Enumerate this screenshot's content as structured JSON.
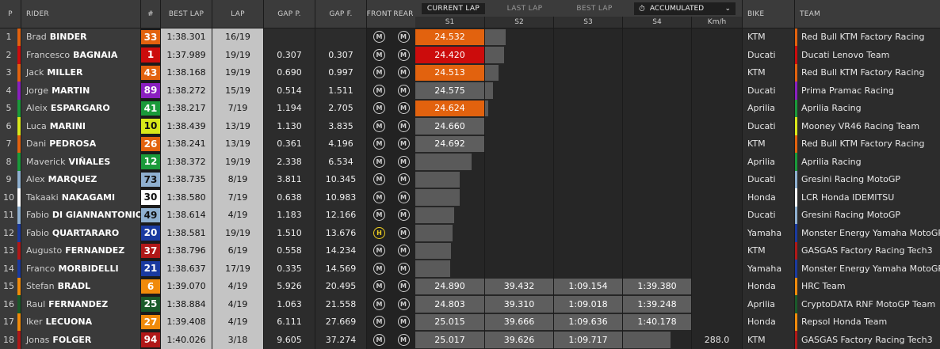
{
  "header": {
    "p": "P",
    "rider": "RIDER",
    "num": "#",
    "best_lap": "BEST LAP",
    "lap": "LAP",
    "gap_p": "GAP P.",
    "gap_f": "GAP F.",
    "front": "FRONT",
    "rear": "REAR",
    "bike": "BIKE",
    "team": "TEAM",
    "tabs": {
      "current": "CURRENT LAP",
      "last": "LAST LAP",
      "best": "BEST LAP"
    },
    "mode": "ACCUMULATED",
    "sectors": [
      "S1",
      "S2",
      "S3",
      "S4",
      "Km/h"
    ]
  },
  "colors": {
    "s1_orange": "#e2620e",
    "s1_red": "#cc0c0c",
    "s1_grey": "#5e5e5e"
  },
  "riders": [
    {
      "pos": "1",
      "first": "Brad",
      "last": "BINDER",
      "num": "33",
      "numBg": "#e2620e",
      "numFg": "#fff",
      "strip": "#e2620e",
      "best": "1:38.301",
      "lap": "16/19",
      "gp": "",
      "gf": "",
      "front": "M",
      "rear": "M",
      "s1": "24.532",
      "s1c": "orange",
      "s2": "",
      "s3": "",
      "s4": "",
      "kmh": "",
      "bar": 0.3,
      "bike": "KTM",
      "team": "Red Bull KTM Factory Racing",
      "teamColor": "#e2620e"
    },
    {
      "pos": "2",
      "first": "Francesco",
      "last": "BAGNAIA",
      "num": "1",
      "numBg": "#cc0c0c",
      "numFg": "#fff",
      "strip": "#cc0c0c",
      "best": "1:37.989",
      "lap": "19/19",
      "gp": "0.307",
      "gf": "0.307",
      "front": "M",
      "rear": "M",
      "s1": "24.420",
      "s1c": "red",
      "s2": "",
      "s3": "",
      "s4": "",
      "kmh": "",
      "bar": 0.28,
      "bike": "Ducati",
      "team": "Ducati Lenovo Team",
      "teamColor": "#cc0c0c"
    },
    {
      "pos": "3",
      "first": "Jack",
      "last": "MILLER",
      "num": "43",
      "numBg": "#e2620e",
      "numFg": "#fff",
      "strip": "#e2620e",
      "best": "1:38.168",
      "lap": "19/19",
      "gp": "0.690",
      "gf": "0.997",
      "front": "M",
      "rear": "M",
      "s1": "24.513",
      "s1c": "orange",
      "s2": "",
      "s3": "",
      "s4": "",
      "kmh": "",
      "bar": 0.2,
      "bike": "KTM",
      "team": "Red Bull KTM Factory Racing",
      "teamColor": "#e2620e"
    },
    {
      "pos": "4",
      "first": "Jorge",
      "last": "MARTIN",
      "num": "89",
      "numBg": "#8a1fc0",
      "numFg": "#fff",
      "strip": "#8a1fc0",
      "best": "1:38.272",
      "lap": "15/19",
      "gp": "0.514",
      "gf": "1.511",
      "front": "M",
      "rear": "M",
      "s1": "24.575",
      "s1c": "grey",
      "s2": "",
      "s3": "",
      "s4": "",
      "kmh": "",
      "bar": 0.12,
      "bike": "Ducati",
      "team": "Prima Pramac Racing",
      "teamColor": "#8a1fc0"
    },
    {
      "pos": "5",
      "first": "Aleix",
      "last": "ESPARGARO",
      "num": "41",
      "numBg": "#1a9a3a",
      "numFg": "#fff",
      "strip": "#1a9a3a",
      "best": "1:38.217",
      "lap": "7/19",
      "gp": "1.194",
      "gf": "2.705",
      "front": "M",
      "rear": "M",
      "s1": "24.624",
      "s1c": "orange",
      "s2": "",
      "s3": "",
      "s4": "",
      "kmh": "",
      "bar": 0.05,
      "bike": "Aprilia",
      "team": "Aprilia Racing",
      "teamColor": "#1a9a3a"
    },
    {
      "pos": "6",
      "first": "Luca",
      "last": "MARINI",
      "num": "10",
      "numBg": "#d8e81a",
      "numFg": "#111",
      "strip": "#d8e81a",
      "best": "1:38.439",
      "lap": "13/19",
      "gp": "1.130",
      "gf": "3.835",
      "front": "M",
      "rear": "M",
      "s1": "24.660",
      "s1c": "grey",
      "s2": "",
      "s3": "",
      "s4": "",
      "kmh": "",
      "bar": 0,
      "bike": "Ducati",
      "team": "Mooney VR46 Racing Team",
      "teamColor": "#d8e81a"
    },
    {
      "pos": "7",
      "first": "Dani",
      "last": "PEDROSA",
      "num": "26",
      "numBg": "#e2620e",
      "numFg": "#fff",
      "strip": "#e2620e",
      "best": "1:38.241",
      "lap": "13/19",
      "gp": "0.361",
      "gf": "4.196",
      "front": "M",
      "rear": "M",
      "s1": "24.692",
      "s1c": "grey",
      "s2": "",
      "s3": "",
      "s4": "",
      "kmh": "",
      "bar": 0,
      "bike": "KTM",
      "team": "Red Bull KTM Factory Racing",
      "teamColor": "#e2620e"
    },
    {
      "pos": "8",
      "first": "Maverick",
      "last": "VIÑALES",
      "num": "12",
      "numBg": "#1a9a3a",
      "numFg": "#fff",
      "strip": "#1a9a3a",
      "best": "1:38.372",
      "lap": "19/19",
      "gp": "2.338",
      "gf": "6.534",
      "front": "M",
      "rear": "M",
      "s1": "",
      "s1c": "bar",
      "s2": "",
      "s3": "",
      "s4": "",
      "kmh": "",
      "bar": 0.82,
      "bike": "Aprilia",
      "team": "Aprilia Racing",
      "teamColor": "#1a9a3a"
    },
    {
      "pos": "9",
      "first": "Alex",
      "last": "MARQUEZ",
      "num": "73",
      "numBg": "#8fb0d0",
      "numFg": "#111",
      "strip": "#8fb0d0",
      "best": "1:38.735",
      "lap": "8/19",
      "gp": "3.811",
      "gf": "10.345",
      "front": "M",
      "rear": "M",
      "s1": "",
      "s1c": "bar",
      "s2": "",
      "s3": "",
      "s4": "",
      "kmh": "",
      "bar": 0.64,
      "bike": "Ducati",
      "team": "Gresini Racing MotoGP",
      "teamColor": "#8fb0d0"
    },
    {
      "pos": "10",
      "first": "Takaaki",
      "last": "NAKAGAMI",
      "num": "30",
      "numBg": "#ffffff",
      "numFg": "#111",
      "strip": "#ffffff",
      "best": "1:38.580",
      "lap": "7/19",
      "gp": "0.638",
      "gf": "10.983",
      "front": "M",
      "rear": "M",
      "s1": "",
      "s1c": "bar",
      "s2": "",
      "s3": "",
      "s4": "",
      "kmh": "",
      "bar": 0.64,
      "bike": "Honda",
      "team": "LCR Honda IDEMITSU",
      "teamColor": "#ffffff"
    },
    {
      "pos": "11",
      "first": "Fabio",
      "last": "DI GIANNANTONIO",
      "num": "49",
      "numBg": "#8fb0d0",
      "numFg": "#111",
      "strip": "#8fb0d0",
      "best": "1:38.614",
      "lap": "4/19",
      "gp": "1.183",
      "gf": "12.166",
      "front": "M",
      "rear": "M",
      "s1": "",
      "s1c": "bar",
      "s2": "",
      "s3": "",
      "s4": "",
      "kmh": "",
      "bar": 0.56,
      "bike": "Ducati",
      "team": "Gresini Racing MotoGP",
      "teamColor": "#8fb0d0"
    },
    {
      "pos": "12",
      "first": "Fabio",
      "last": "QUARTARARO",
      "num": "20",
      "numBg": "#1a3aa0",
      "numFg": "#fff",
      "strip": "#1a3aa0",
      "best": "1:38.581",
      "lap": "19/19",
      "gp": "1.510",
      "gf": "13.676",
      "front": "H",
      "rear": "M",
      "s1": "",
      "s1c": "bar",
      "s2": "",
      "s3": "",
      "s4": "",
      "kmh": "",
      "bar": 0.54,
      "bike": "Yamaha",
      "team": "Monster Energy Yamaha MotoGP",
      "teamColor": "#1a3aa0"
    },
    {
      "pos": "13",
      "first": "Augusto",
      "last": "FERNANDEZ",
      "num": "37",
      "numBg": "#b01818",
      "numFg": "#fff",
      "strip": "#b01818",
      "best": "1:38.796",
      "lap": "6/19",
      "gp": "0.558",
      "gf": "14.234",
      "front": "M",
      "rear": "M",
      "s1": "",
      "s1c": "bar",
      "s2": "",
      "s3": "",
      "s4": "",
      "kmh": "",
      "bar": 0.52,
      "bike": "KTM",
      "team": "GASGAS Factory Racing Tech3",
      "teamColor": "#b01818"
    },
    {
      "pos": "14",
      "first": "Franco",
      "last": "MORBIDELLI",
      "num": "21",
      "numBg": "#1a3aa0",
      "numFg": "#fff",
      "strip": "#1a3aa0",
      "best": "1:38.637",
      "lap": "17/19",
      "gp": "0.335",
      "gf": "14.569",
      "front": "M",
      "rear": "M",
      "s1": "",
      "s1c": "bar",
      "s2": "",
      "s3": "",
      "s4": "",
      "kmh": "",
      "bar": 0.5,
      "bike": "Yamaha",
      "team": "Monster Energy Yamaha MotoGP",
      "teamColor": "#1a3aa0"
    },
    {
      "pos": "15",
      "first": "Stefan",
      "last": "BRADL",
      "num": "6",
      "numBg": "#f08a0a",
      "numFg": "#fff",
      "strip": "#f08a0a",
      "best": "1:39.070",
      "lap": "4/19",
      "gp": "5.926",
      "gf": "20.495",
      "front": "M",
      "rear": "M",
      "s1": "24.890",
      "s1c": "grey",
      "s2": "39.432",
      "s3": "1:09.154",
      "s4": "1:39.380",
      "kmh": "",
      "bar": 0,
      "bike": "Honda",
      "team": "HRC Team",
      "teamColor": "#f08a0a"
    },
    {
      "pos": "16",
      "first": "Raul",
      "last": "FERNANDEZ",
      "num": "25",
      "numBg": "#1a5a2a",
      "numFg": "#fff",
      "strip": "#1a5a2a",
      "best": "1:38.884",
      "lap": "4/19",
      "gp": "1.063",
      "gf": "21.558",
      "front": "M",
      "rear": "M",
      "s1": "24.803",
      "s1c": "grey",
      "s2": "39.310",
      "s3": "1:09.018",
      "s4": "1:39.248",
      "kmh": "",
      "bar": 0,
      "bike": "Aprilia",
      "team": "CryptoDATA RNF MotoGP Team",
      "teamColor": "#1a5a2a"
    },
    {
      "pos": "17",
      "first": "Iker",
      "last": "LECUONA",
      "num": "27",
      "numBg": "#f08a0a",
      "numFg": "#fff",
      "strip": "#f08a0a",
      "best": "1:39.408",
      "lap": "4/19",
      "gp": "6.111",
      "gf": "27.669",
      "front": "M",
      "rear": "M",
      "s1": "25.015",
      "s1c": "grey",
      "s2": "39.666",
      "s3": "1:09.636",
      "s4": "1:40.178",
      "kmh": "",
      "bar": 0,
      "bike": "Honda",
      "team": "Repsol Honda Team",
      "teamColor": "#f08a0a"
    },
    {
      "pos": "18",
      "first": "Jonas",
      "last": "FOLGER",
      "num": "94",
      "numBg": "#b01818",
      "numFg": "#fff",
      "strip": "#b01818",
      "best": "1:40.026",
      "lap": "3/18",
      "gp": "9.605",
      "gf": "37.274",
      "front": "M",
      "rear": "M",
      "s1": "25.017",
      "s1c": "grey",
      "s2": "39.626",
      "s3": "1:09.717",
      "s4": "",
      "kmh": "288.0",
      "bar": 0,
      "bike": "KTM",
      "team": "GASGAS Factory Racing Tech3",
      "teamColor": "#b01818"
    }
  ]
}
